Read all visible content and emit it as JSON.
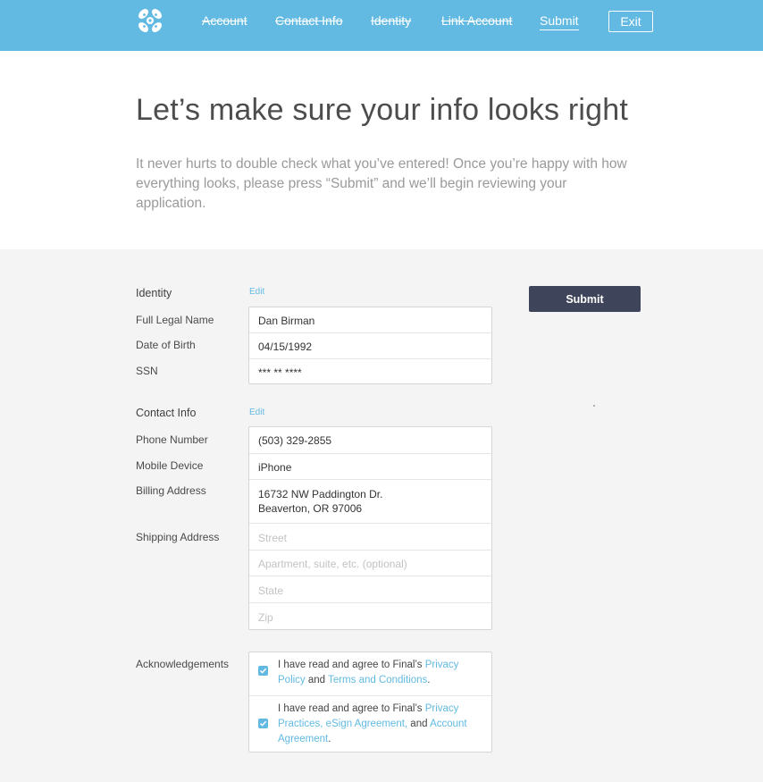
{
  "nav": {
    "logo": "final-logo-icon",
    "items": [
      {
        "label": "Account",
        "state": "done"
      },
      {
        "label": "Contact Info",
        "state": "done"
      },
      {
        "label": "Identity",
        "state": "done"
      },
      {
        "label": "Link Account",
        "state": "done"
      },
      {
        "label": "Submit",
        "state": "current"
      }
    ],
    "exit_label": "Exit",
    "color": "#62bae2"
  },
  "hero": {
    "title": "Let’s make sure your info looks right",
    "text": "It never hurts to double check what you’ve entered! Once you’re happy with how everything looks, please press “Submit” and we’ll begin reviewing your application."
  },
  "identity": {
    "title": "Identity",
    "edit": "Edit",
    "fields": [
      {
        "label": "Full Legal Name",
        "value": "Dan Birman"
      },
      {
        "label": "Date of Birth",
        "value": "04/15/1992"
      },
      {
        "label": "SSN",
        "value": "*** ** ****"
      }
    ]
  },
  "contact": {
    "title": "Contact Info",
    "edit": "Edit",
    "phone_label": "Phone Number",
    "phone": "(503) 329-2855",
    "mobile_label": "Mobile Device",
    "mobile": "iPhone",
    "billing_label": "Billing Address",
    "billing_line1": "16732 NW Paddington Dr.",
    "billing_line2": "Beaverton, OR 97006",
    "shipping_label": "Shipping Address",
    "shipping_placeholders": {
      "street": "Street",
      "apartment": "Apartment, suite, etc. (optional)",
      "state": "State",
      "zip": "Zip"
    }
  },
  "acknowledgements": {
    "label": "Acknowledgements",
    "items": [
      {
        "checked": true,
        "prefix": "I have read and agree to Final’s ",
        "link1": "Privacy Policy",
        "mid": " and ",
        "link2": "Terms and Conditions",
        "suffix": "."
      },
      {
        "checked": true,
        "prefix": "I have read and agree to Final’s ",
        "link1": "Privacy Practices, eSign Agreement,",
        "mid": " and ",
        "link2": "Account Agreement",
        "suffix": "."
      }
    ]
  },
  "submit_label": "Submit"
}
